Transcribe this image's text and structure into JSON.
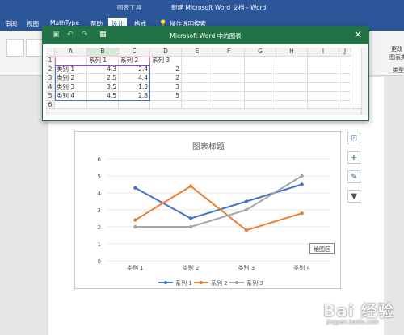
{
  "word": {
    "contextual_tab": "图表工具",
    "doc_title": "新建 Microsoft Word 文档 - Word",
    "tabs": [
      "审阅",
      "视图",
      "MathType",
      "帮助",
      "设计",
      "格式"
    ],
    "active_tab": "设计",
    "tell_me": "操作说明搜索",
    "right_buttons": [
      "更改",
      "图表类",
      "类型"
    ]
  },
  "sheet": {
    "title": "Microsoft Word 中的图表",
    "col_headers": [
      "A",
      "B",
      "C",
      "D",
      "E",
      "F",
      "G",
      "H",
      "I",
      "J"
    ],
    "row_headers": [
      "1",
      "2",
      "3",
      "4",
      "5",
      "6"
    ],
    "header_row": [
      "",
      "系列 1",
      "系列 2",
      "系列 3"
    ],
    "rows": [
      [
        "类别 1",
        "4.3",
        "2.4",
        "2"
      ],
      [
        "类别 2",
        "2.5",
        "4.4",
        "2"
      ],
      [
        "类别 3",
        "3.5",
        "1.8",
        "3"
      ],
      [
        "类别 4",
        "4.5",
        "2.8",
        "5"
      ]
    ]
  },
  "chart_data": {
    "type": "line",
    "title": "图表标题",
    "categories": [
      "类别 1",
      "类别 2",
      "类别 3",
      "类别 4"
    ],
    "series": [
      {
        "name": "系列 1",
        "values": [
          4.3,
          2.5,
          3.5,
          4.5
        ],
        "color": "#4472c4"
      },
      {
        "name": "系列 2",
        "values": [
          2.4,
          4.4,
          1.8,
          2.8
        ],
        "color": "#ed7d31"
      },
      {
        "name": "系列 3",
        "values": [
          2,
          2,
          3,
          5
        ],
        "color": "#a5a5a5"
      }
    ],
    "ylim": [
      0,
      6
    ],
    "yticks": [
      "0",
      "1",
      "2",
      "3",
      "4",
      "5",
      "6"
    ],
    "grid": true,
    "legend": "bottom"
  },
  "tooltip": "绘图区",
  "side_tools": [
    "layout-options-icon",
    "add-chart-element-icon",
    "chart-styles-icon",
    "chart-filter-icon"
  ],
  "watermark": {
    "main": "Bai 经验",
    "sub": "jingyan.baidu.com"
  }
}
